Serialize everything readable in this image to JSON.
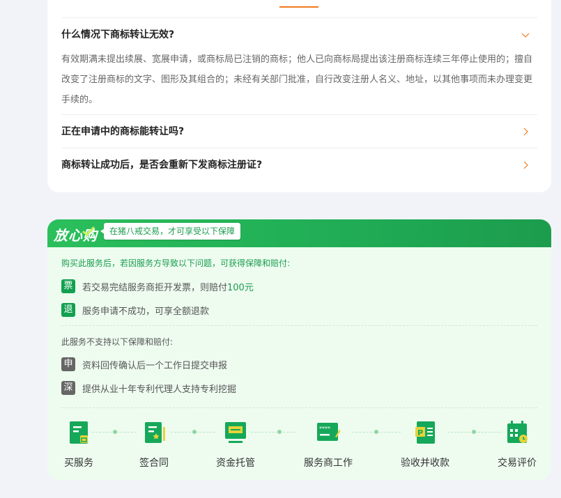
{
  "faq": {
    "items": [
      {
        "question": "什么情况下商标转让无效?",
        "answer": "有效期满未提出续展、宽展申请，或商标局已注销的商标；他人已向商标局提出该注册商标连续三年停止使用的；擅自改变了注册商标的文字、图形及其组合的；未经有关部门批准，自行改变注册人名义、地址，以其他事项而未办理变更手续的。",
        "expanded": true
      },
      {
        "question": "正在申请中的商标能转让吗?",
        "expanded": false
      },
      {
        "question": "商标转让成功后，是否会重新下发商标注册证?",
        "expanded": false
      }
    ]
  },
  "guarantee": {
    "logo": "放心购",
    "slogan": "在猪八戒交易，才可享受以下保障",
    "intro": "购买此服务后，若因服务方导致以下问题，可获得保障和赔付:",
    "supported": [
      {
        "badge": "票",
        "text_before": "若交易完结服务商拒开发票，则赔付",
        "highlight": "100元"
      },
      {
        "badge": "退",
        "text_before": "服务申请不成功，可享全额退款",
        "highlight": ""
      }
    ],
    "unsupported_title": "此服务不支持以下保障和赔付:",
    "unsupported": [
      {
        "badge": "申",
        "text": "资料回传确认后一个工作日提交申报"
      },
      {
        "badge": "深",
        "text": "提供从业十年专利代理人支持专利挖掘"
      }
    ],
    "steps": [
      {
        "label": "买服务",
        "icon": "buy-service-icon"
      },
      {
        "label": "签合同",
        "icon": "sign-contract-icon"
      },
      {
        "label": "资金托管",
        "icon": "fund-escrow-icon"
      },
      {
        "label": "服务商工作",
        "icon": "provider-work-icon"
      },
      {
        "label": "验收并收款",
        "icon": "accept-payment-icon"
      },
      {
        "label": "交易评价",
        "icon": "trade-review-icon"
      }
    ]
  },
  "colors": {
    "accent_orange": "#f07a1e",
    "brand_green": "#1a9c4e",
    "card_bg": "#eefcf0"
  }
}
